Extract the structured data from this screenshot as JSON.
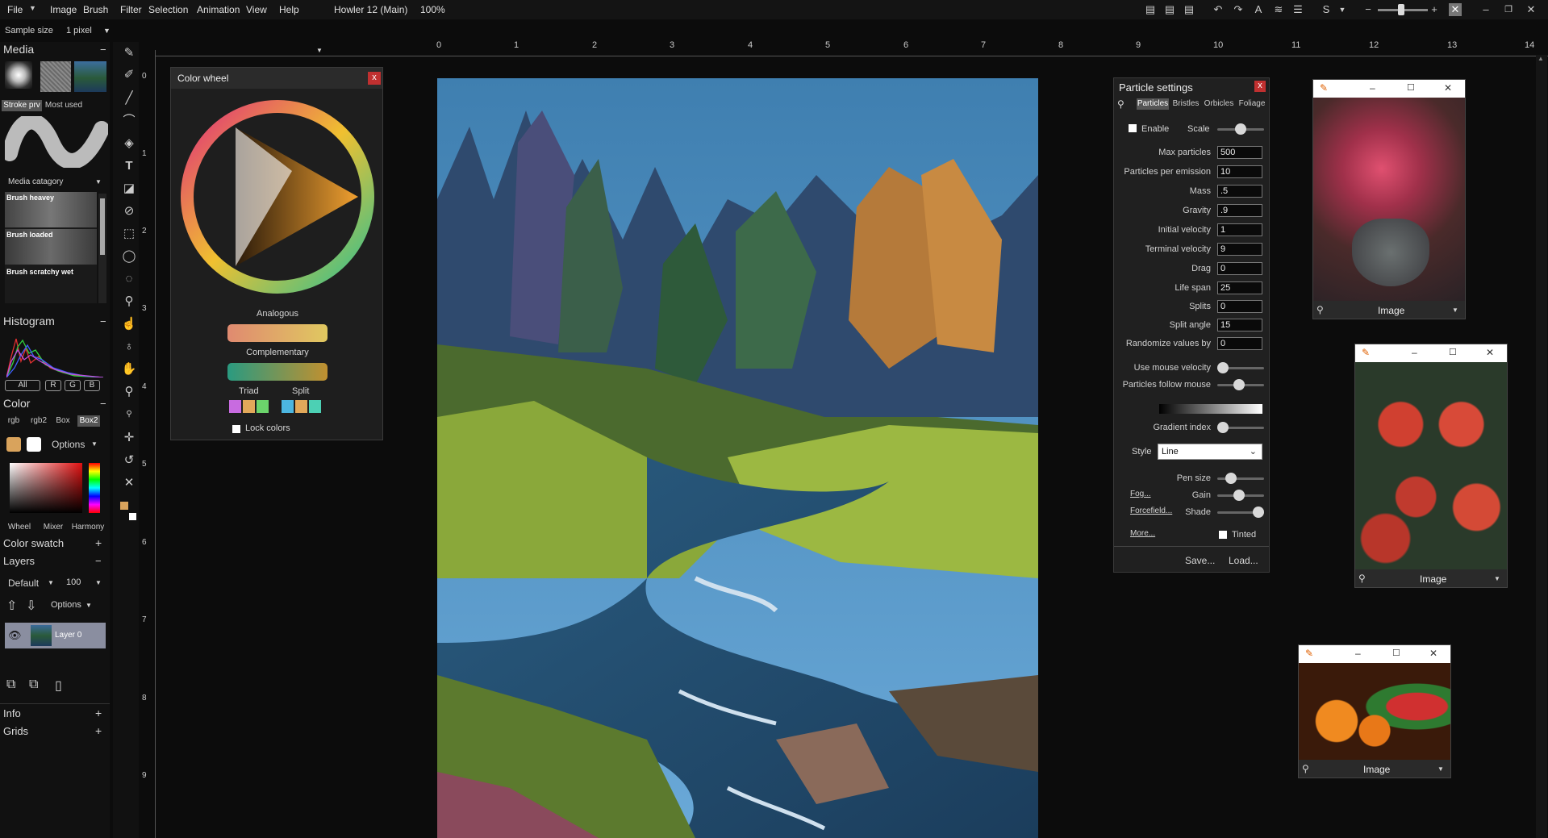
{
  "menu": {
    "items": [
      "File",
      "Image",
      "Brush",
      "Filter",
      "Selection",
      "Animation",
      "View",
      "Help"
    ],
    "title": "Howler 12 (Main)",
    "zoom": "100%"
  },
  "tool_options": {
    "sample_label": "Sample size",
    "sample_value": "1 pixel"
  },
  "left_panel": {
    "media_header": "Media",
    "media_tabs": [
      "Stroke prv",
      "Most used"
    ],
    "media_category": "Media catagory",
    "brushes": [
      "Brush heavey",
      "Brush loaded",
      "Brush scratchy wet"
    ],
    "histogram_header": "Histogram",
    "histogram_channels": [
      "All",
      "R",
      "G",
      "B"
    ],
    "color_header": "Color",
    "color_tabs": [
      "rgb",
      "rgb2",
      "Box",
      "Box2"
    ],
    "options_label": "Options",
    "color_modes": [
      "Wheel",
      "Mixer",
      "Harmony"
    ],
    "color_swatch_header": "Color swatch",
    "layers_header": "Layers",
    "layer_mode": "Default",
    "layer_opacity": "100",
    "layer_options": "Options",
    "layer_name": "Layer 0",
    "info_header": "Info",
    "grids_header": "Grids",
    "colors": {
      "fg": "#d9a35c",
      "bg": "#ffffff"
    }
  },
  "color_wheel": {
    "title": "Color wheel",
    "close": "x",
    "analogous": "Analogous",
    "complementary": "Complementary",
    "triad": "Triad",
    "split": "Split",
    "lock_colors": "Lock colors",
    "triad_colors": [
      "#c86be0",
      "#e2a85a",
      "#6bd46b"
    ],
    "split_colors": [
      "#4cb6e0",
      "#e2a85a",
      "#4cd0b4"
    ]
  },
  "rulers": {
    "h": [
      "0",
      "1",
      "2",
      "3",
      "4",
      "5",
      "6",
      "7",
      "8",
      "9",
      "10",
      "11",
      "12",
      "13",
      "14"
    ],
    "v": [
      "0",
      "1",
      "2",
      "3",
      "4",
      "5",
      "6",
      "7",
      "8",
      "9"
    ]
  },
  "particle_settings": {
    "title": "Particle settings",
    "close": "x",
    "tabs": [
      "Particles",
      "Bristles",
      "Orbicles",
      "Foliage"
    ],
    "enable_label": "Enable",
    "scale_label": "Scale",
    "fields": [
      {
        "label": "Max particles",
        "value": "500"
      },
      {
        "label": "Particles per emission",
        "value": "10"
      },
      {
        "label": "Mass",
        "value": ".5"
      },
      {
        "label": "Gravity",
        "value": ".9"
      },
      {
        "label": "Initial velocity",
        "value": "1"
      },
      {
        "label": "Terminal velocity",
        "value": "9"
      },
      {
        "label": "Drag",
        "value": "0"
      },
      {
        "label": "Life span",
        "value": "25"
      },
      {
        "label": "Splits",
        "value": "0"
      },
      {
        "label": "Split angle",
        "value": "15"
      },
      {
        "label": "Randomize values by",
        "value": "0"
      }
    ],
    "use_mouse_velocity": "Use mouse velocity",
    "particles_follow_mouse": "Particles follow mouse",
    "gradient_index": "Gradient index",
    "style_label": "Style",
    "style_value": "Line",
    "pen_size": "Pen size",
    "fog": "Fog...",
    "gain": "Gain",
    "forcefield": "Forcefield...",
    "shade": "Shade",
    "more": "More...",
    "tinted": "Tinted",
    "save": "Save...",
    "load": "Load..."
  },
  "image_windows": [
    {
      "label": "Image"
    },
    {
      "label": "Image"
    },
    {
      "label": "Image"
    }
  ]
}
